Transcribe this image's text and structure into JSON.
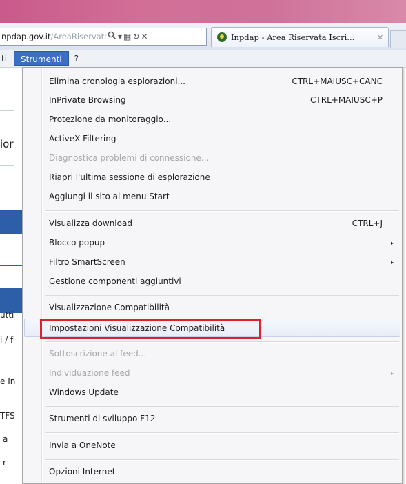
{
  "browser": {
    "address": {
      "host": "npdap.gov.it",
      "path": "/AreaRiservata",
      "search_icon": "search-icon",
      "dropdown_glyph": "▾",
      "compat_glyph": "▦",
      "refresh_glyph": "↻",
      "stop_glyph": "✕"
    },
    "tab": {
      "title": "Inpdap - Area Riservata Iscri...",
      "close_glyph": "✕"
    }
  },
  "menubar": {
    "items": [
      "ti",
      "Strumenti",
      "?"
    ]
  },
  "page_fragments": [
    "ior",
    "utti",
    "i / f",
    "e In",
    "TFS",
    "a",
    "r"
  ],
  "menu": {
    "items": [
      {
        "label": "Elimina cronologia esplorazioni...",
        "shortcut": "CTRL+MAIUSC+CANC"
      },
      {
        "label": "InPrivate Browsing",
        "shortcut": "CTRL+MAIUSC+P"
      },
      {
        "label": "Protezione da monitoraggio..."
      },
      {
        "label": "ActiveX Filtering"
      },
      {
        "label": "Diagnostica problemi di connessione..."
      },
      {
        "label": "Riapri l'ultima sessione di esplorazione"
      },
      {
        "label": "Aggiungi il sito al menu Start"
      },
      {
        "label": "Visualizza download",
        "shortcut": "CTRL+J"
      },
      {
        "label": "Blocco popup",
        "arrow": "▸"
      },
      {
        "label": "Filtro SmartScreen",
        "arrow": "▸"
      },
      {
        "label": "Gestione componenti aggiuntivi"
      },
      {
        "label": "Visualizzazione Compatibilità"
      },
      {
        "label": "Impostazioni Visualizzazione Compatibilità"
      },
      {
        "label": "Sottoscrizione al feed..."
      },
      {
        "label": "Individuazione feed",
        "arrow": "▸"
      },
      {
        "label": "Windows Update"
      },
      {
        "label": "Strumenti di sviluppo F12"
      },
      {
        "label": "Invia a OneNote"
      },
      {
        "label": "Opzioni Internet"
      }
    ]
  },
  "colors": {
    "menu_active": "#3a6fc4",
    "annotation_box": "#e0202f",
    "page_band": "#2d5ea8"
  }
}
